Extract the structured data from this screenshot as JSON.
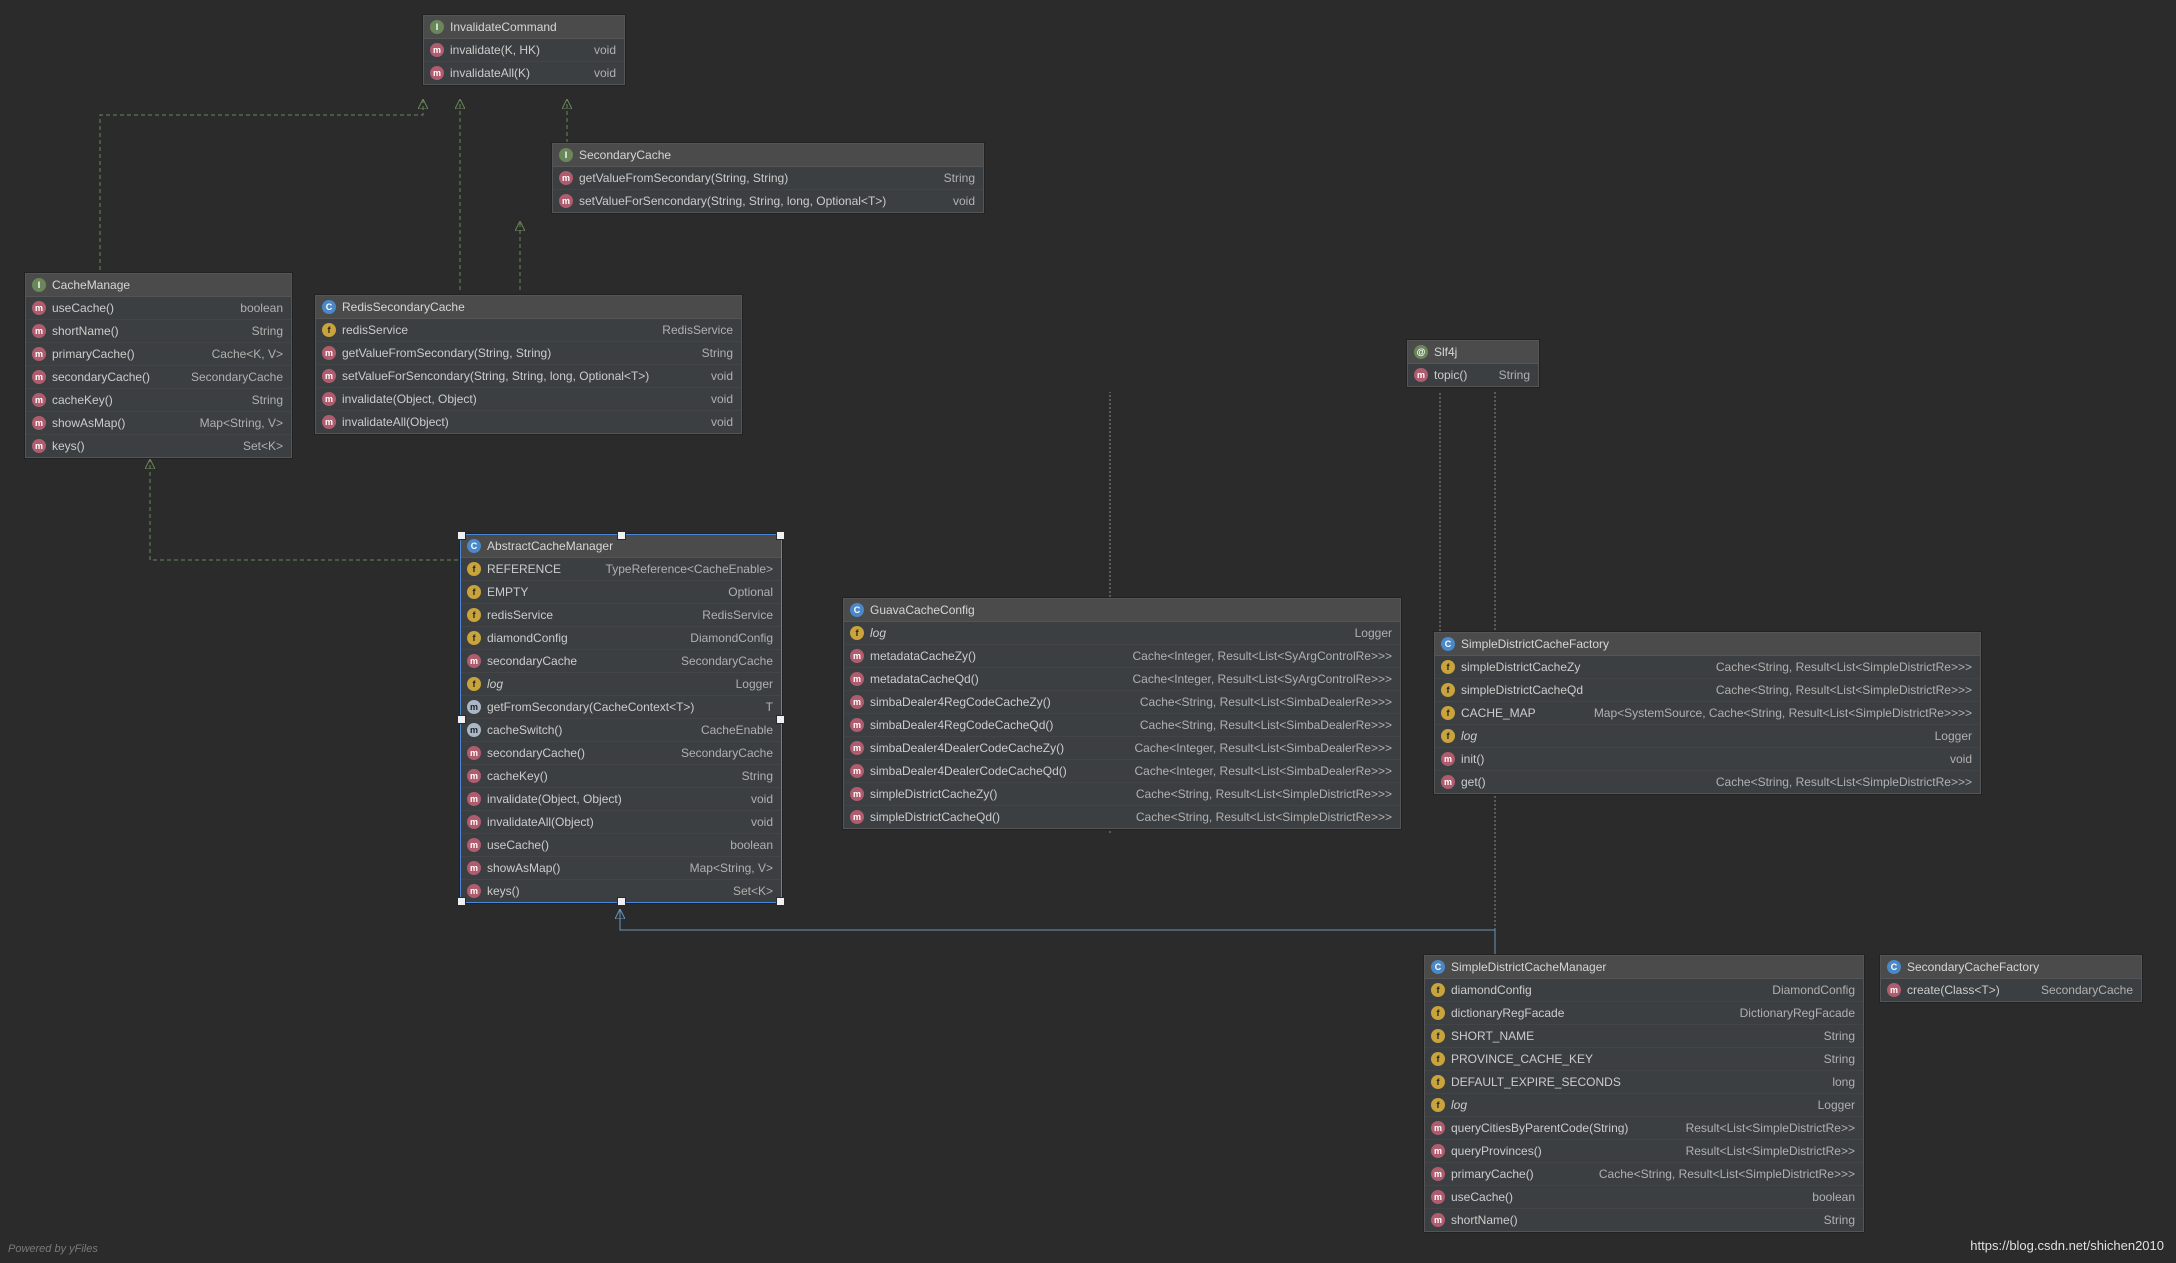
{
  "footer_left": "Powered by yFiles",
  "footer_right": "https://blog.csdn.net/shichen2010",
  "diagram": {
    "InvalidateCommand": {
      "kind": "interface",
      "title": "InvalidateCommand",
      "rows": [
        {
          "icon": "method",
          "name": "invalidate(K, HK)",
          "type": "void"
        },
        {
          "icon": "method",
          "name": "invalidateAll(K)",
          "type": "void"
        }
      ]
    },
    "SecondaryCache": {
      "kind": "interface",
      "title": "SecondaryCache",
      "rows": [
        {
          "icon": "method",
          "name": "getValueFromSecondary(String, String)",
          "type": "String"
        },
        {
          "icon": "method",
          "name": "setValueForSencondary(String, String, long, Optional<T>)",
          "type": "void"
        }
      ]
    },
    "CacheManage": {
      "kind": "interface",
      "title": "CacheManage",
      "rows": [
        {
          "icon": "method",
          "name": "useCache()",
          "type": "boolean"
        },
        {
          "icon": "method",
          "name": "shortName()",
          "type": "String"
        },
        {
          "icon": "method",
          "name": "primaryCache()",
          "type": "Cache<K, V>"
        },
        {
          "icon": "method",
          "name": "secondaryCache()",
          "type": "SecondaryCache"
        },
        {
          "icon": "method",
          "name": "cacheKey()",
          "type": "String"
        },
        {
          "icon": "method",
          "name": "showAsMap()",
          "type": "Map<String, V>"
        },
        {
          "icon": "method",
          "name": "keys()",
          "type": "Set<K>"
        }
      ]
    },
    "RedisSecondaryCache": {
      "kind": "class",
      "title": "RedisSecondaryCache",
      "rows": [
        {
          "icon": "field",
          "name": "redisService",
          "type": "RedisService"
        },
        {
          "icon": "method",
          "name": "getValueFromSecondary(String, String)",
          "type": "String"
        },
        {
          "icon": "method",
          "name": "setValueForSencondary(String, String, long, Optional<T>)",
          "type": "void"
        },
        {
          "icon": "method",
          "name": "invalidate(Object, Object)",
          "type": "void"
        },
        {
          "icon": "method",
          "name": "invalidateAll(Object)",
          "type": "void"
        }
      ]
    },
    "Slf4j": {
      "kind": "annot",
      "title": "Slf4j",
      "rows": [
        {
          "icon": "method",
          "name": "topic()",
          "type": "String"
        }
      ]
    },
    "AbstractCacheManager": {
      "kind": "class",
      "title": "AbstractCacheManager",
      "selected": true,
      "rows": [
        {
          "icon": "static",
          "name": "REFERENCE",
          "type": "TypeReference<CacheEnable>"
        },
        {
          "icon": "static",
          "name": "EMPTY",
          "type": "Optional"
        },
        {
          "icon": "field",
          "name": "redisService",
          "type": "RedisService"
        },
        {
          "icon": "field",
          "name": "diamondConfig",
          "type": "DiamondConfig"
        },
        {
          "icon": "method",
          "name": "secondaryCache",
          "type": "SecondaryCache"
        },
        {
          "icon": "lock",
          "name": "log",
          "type": "Logger",
          "italic": true
        },
        {
          "icon": "abs",
          "name": "getFromSecondary(CacheContext<T>)",
          "type": "T"
        },
        {
          "icon": "abs",
          "name": "cacheSwitch()",
          "type": "CacheEnable"
        },
        {
          "icon": "method",
          "name": "secondaryCache()",
          "type": "SecondaryCache"
        },
        {
          "icon": "method",
          "name": "cacheKey()",
          "type": "String"
        },
        {
          "icon": "method",
          "name": "invalidate(Object, Object)",
          "type": "void"
        },
        {
          "icon": "method",
          "name": "invalidateAll(Object)",
          "type": "void"
        },
        {
          "icon": "method",
          "name": "useCache()",
          "type": "boolean"
        },
        {
          "icon": "method",
          "name": "showAsMap()",
          "type": "Map<String, V>"
        },
        {
          "icon": "method",
          "name": "keys()",
          "type": "Set<K>"
        }
      ]
    },
    "GuavaCacheConfig": {
      "kind": "class",
      "title": "GuavaCacheConfig",
      "rows": [
        {
          "icon": "lock",
          "name": "log",
          "type": "Logger",
          "italic": true
        },
        {
          "icon": "method",
          "name": "metadataCacheZy()",
          "type": "Cache<Integer, Result<List<SyArgControlRe>>>"
        },
        {
          "icon": "method",
          "name": "metadataCacheQd()",
          "type": "Cache<Integer, Result<List<SyArgControlRe>>>"
        },
        {
          "icon": "method",
          "name": "simbaDealer4RegCodeCacheZy()",
          "type": "Cache<String, Result<List<SimbaDealerRe>>>"
        },
        {
          "icon": "method",
          "name": "simbaDealer4RegCodeCacheQd()",
          "type": "Cache<String, Result<List<SimbaDealerRe>>>"
        },
        {
          "icon": "method",
          "name": "simbaDealer4DealerCodeCacheZy()",
          "type": "Cache<Integer, Result<List<SimbaDealerRe>>>"
        },
        {
          "icon": "method",
          "name": "simbaDealer4DealerCodeCacheQd()",
          "type": "Cache<Integer, Result<List<SimbaDealerRe>>>"
        },
        {
          "icon": "method",
          "name": "simpleDistrictCacheZy()",
          "type": "Cache<String, Result<List<SimpleDistrictRe>>>"
        },
        {
          "icon": "method",
          "name": "simpleDistrictCacheQd()",
          "type": "Cache<String, Result<List<SimpleDistrictRe>>>"
        }
      ]
    },
    "SimpleDistrictCacheFactory": {
      "kind": "class",
      "title": "SimpleDistrictCacheFactory",
      "rows": [
        {
          "icon": "field",
          "name": "simpleDistrictCacheZy",
          "type": "Cache<String, Result<List<SimpleDistrictRe>>>"
        },
        {
          "icon": "field",
          "name": "simpleDistrictCacheQd",
          "type": "Cache<String, Result<List<SimpleDistrictRe>>>"
        },
        {
          "icon": "static",
          "name": "CACHE_MAP",
          "type": "Map<SystemSource, Cache<String, Result<List<SimpleDistrictRe>>>>"
        },
        {
          "icon": "lock",
          "name": "log",
          "type": "Logger",
          "italic": true
        },
        {
          "icon": "method",
          "name": "init()",
          "type": "void"
        },
        {
          "icon": "method",
          "name": "get()",
          "type": "Cache<String, Result<List<SimpleDistrictRe>>>"
        }
      ]
    },
    "SimpleDistrictCacheManager": {
      "kind": "class",
      "title": "SimpleDistrictCacheManager",
      "rows": [
        {
          "icon": "field",
          "name": "diamondConfig",
          "type": "DiamondConfig"
        },
        {
          "icon": "field",
          "name": "dictionaryRegFacade",
          "type": "DictionaryRegFacade"
        },
        {
          "icon": "static",
          "name": "SHORT_NAME",
          "type": "String"
        },
        {
          "icon": "static",
          "name": "PROVINCE_CACHE_KEY",
          "type": "String"
        },
        {
          "icon": "static",
          "name": "DEFAULT_EXPIRE_SECONDS",
          "type": "long"
        },
        {
          "icon": "lock",
          "name": "log",
          "type": "Logger",
          "italic": true
        },
        {
          "icon": "method",
          "name": "queryCitiesByParentCode(String)",
          "type": "Result<List<SimpleDistrictRe>>"
        },
        {
          "icon": "method",
          "name": "queryProvinces()",
          "type": "Result<List<SimpleDistrictRe>>"
        },
        {
          "icon": "method",
          "name": "primaryCache()",
          "type": "Cache<String, Result<List<SimpleDistrictRe>>>"
        },
        {
          "icon": "method",
          "name": "useCache()",
          "type": "boolean"
        },
        {
          "icon": "method",
          "name": "shortName()",
          "type": "String"
        }
      ]
    },
    "SecondaryCacheFactory": {
      "kind": "class",
      "title": "SecondaryCacheFactory",
      "rows": [
        {
          "icon": "method",
          "name": "create(Class<T>)",
          "type": "SecondaryCache"
        }
      ]
    }
  }
}
